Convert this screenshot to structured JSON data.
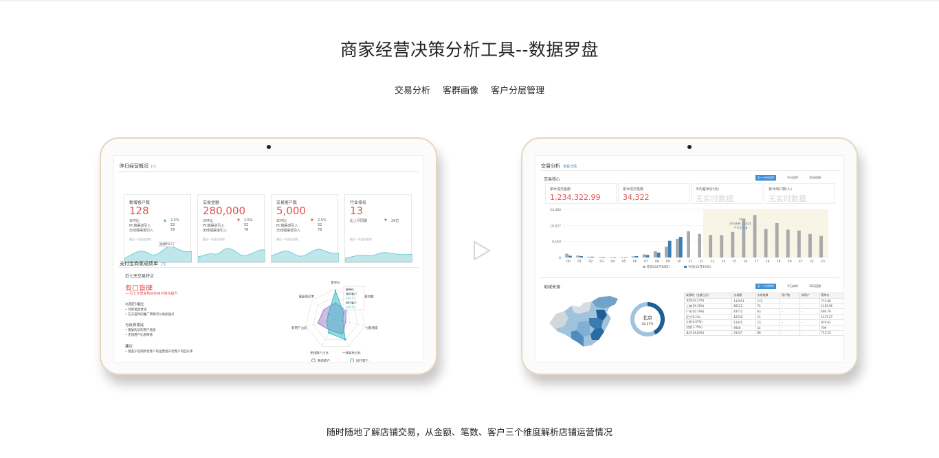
{
  "page": {
    "title": "商家经营决策分析工具--数据罗盘",
    "tabs": [
      "交易分析",
      "客群画像",
      "客户分层管理"
    ],
    "caption": "随时随地了解店铺交易，从金额、笔数、客户三个维度解析店铺运营情况"
  },
  "left_screen": {
    "overview_title": "昨日经营概况",
    "overview_link": "[?]",
    "cards": [
      {
        "label": "新增客户数",
        "value": "128",
        "rows": [
          [
            "日环比",
            "▲",
            "2.5%"
          ],
          [
            "PC端渠道引入",
            "",
            "52"
          ],
          [
            "无线端渠道引入",
            "",
            "78"
          ]
        ],
        "trend": "最近一年变化趋势",
        "tooltip": "新增5%人"
      },
      {
        "label": "交易金额",
        "value": "280,000",
        "rows": [
          [
            "日环比",
            "▼",
            "2.5%"
          ],
          [
            "PC端渠道引入",
            "",
            "52"
          ],
          [
            "无线端渠道引入",
            "",
            "78"
          ]
        ],
        "trend": "最近一年变化趋势"
      },
      {
        "label": "交易客户数",
        "value": "5,000",
        "rows": [
          [
            "日环比",
            "▼",
            "2.5%"
          ],
          [
            "PC端渠道引入",
            "",
            "52"
          ],
          [
            "无线端渠道引入",
            "",
            "78"
          ]
        ],
        "trend": "最近一年变化趋势"
      },
      {
        "label": "行业排名",
        "value": "13",
        "rows": [
          [
            "比上月同期",
            "▼",
            "29位"
          ]
        ],
        "trend": "最近一年变化趋势"
      }
    ],
    "health_title": "支付宝商家成绩单",
    "health_link": "[?]",
    "features_title": "近七天交易特点",
    "badge": "有口皆碑",
    "badge_note": "— 近七天重复购买的用户转化提升",
    "compare1_title": "与同行相比",
    "compare1_items": [
      "• 付款速度更快",
      "• 在天猫和的推广策略可以再加强点"
    ],
    "compare2_title": "与自身相比",
    "compare2_items": [
      "• 重复购买的用户增多",
      "• 无线用户比例降低"
    ],
    "advice_title": "建议",
    "advice_items": [
      "• 借鉴于近期新老客户的运营提升老客户的回头率"
    ],
    "radar_axes": [
      "客单价",
      "人均消费次数",
      "付款速度",
      "一线城市占比",
      "无线用户占比",
      "新用户占比",
      "重复购买率"
    ],
    "radar_tooltip": [
      "客单价",
      "我的客户",
      "345.53",
      "同行客户",
      "245.53"
    ],
    "legend": [
      "我的客户",
      "同行客户"
    ],
    "mine_values": [
      0.55,
      0.45,
      0.35,
      0.55,
      0.4,
      0.6,
      0.5
    ],
    "peer_values": [
      0.95,
      0.35,
      0.25,
      0.75,
      0.5,
      0.3,
      0.3
    ]
  },
  "right_screen": {
    "section_title": "交易分析",
    "section_link": "查看详情",
    "center_title": "交易核心",
    "time_pills": [
      "近一小时实时",
      "今日实时",
      "30天回顾"
    ],
    "kpis": [
      {
        "label": "累计成交金额",
        "value": "1,234,322.99",
        "gray": false
      },
      {
        "label": "累计成交笔数",
        "value": "34,322",
        "gray": false
      },
      {
        "label": "平均客单价(元)",
        "value": "无实时数据",
        "gray": true
      },
      {
        "label": "累计用户数(人)",
        "value": "无实时数据",
        "gray": true
      }
    ],
    "region_title": "地域来源",
    "region_pills": [
      "近一小时实时",
      "今日实时",
      "30天回顾"
    ],
    "map_label": "北京",
    "map_pct": "42.27%",
    "table_headers": [
      "来源地（金额占比）",
      "交易额",
      "交易笔数",
      "用户数",
      "新用户",
      "客单价"
    ],
    "table_rows": [
      [
        "北京(42.27%)",
        "132053",
        "172",
        "-",
        "-",
        "772.98"
      ],
      [
        "上海(19.19%)",
        "86133",
        "74",
        "-",
        "-",
        "1163.96"
      ],
      [
        "广东(10.79%)",
        "43772",
        "63",
        "-",
        "-",
        "694.79"
      ],
      [
        "辽宁(5.1%)",
        "12510",
        "11",
        "-",
        "-",
        "1137.27"
      ],
      [
        "江苏(4.07%)",
        "11435",
        "13",
        "-",
        "-",
        "879.62"
      ],
      [
        "河北(3.75%)",
        "9926",
        "14",
        "-",
        "-",
        "709"
      ],
      [
        "其它(14.83%)",
        "61537",
        "86",
        "-",
        "-",
        "715.55"
      ]
    ]
  },
  "chart_data": {
    "type": "bar",
    "categories": [
      "00",
      "01",
      "02",
      "03",
      "04",
      "05",
      "06",
      "07",
      "08",
      "09",
      "10",
      "11",
      "12",
      "13",
      "14",
      "15",
      "16",
      "17",
      "18",
      "19",
      "20",
      "21",
      "22",
      "23"
    ],
    "ylabels": [
      "24,480",
      "16,327",
      "8,163",
      "0"
    ],
    "ylim": [
      0,
      24480
    ],
    "series": [
      {
        "name": "昨日(02月18日)",
        "color": "#a9a9a9",
        "values": [
          1900,
          1000,
          400,
          300,
          250,
          250,
          600,
          1600,
          3200,
          5500,
          9500,
          13400,
          12000,
          11500,
          11400,
          13000,
          19800,
          21600,
          14500,
          17500,
          14200,
          13700,
          12000,
          11000
        ]
      },
      {
        "name": "今日(02月19日)",
        "color": "#3a7fb5",
        "values": [
          900,
          700,
          400,
          300,
          250,
          250,
          700,
          1300,
          2500,
          8500,
          10500,
          0,
          0,
          0,
          0,
          0,
          0,
          0,
          0,
          0,
          0,
          0,
          0,
          0
        ]
      }
    ],
    "tooltip": [
      "14",
      "同行客单 23,824",
      "今日实时 ▮"
    ]
  }
}
